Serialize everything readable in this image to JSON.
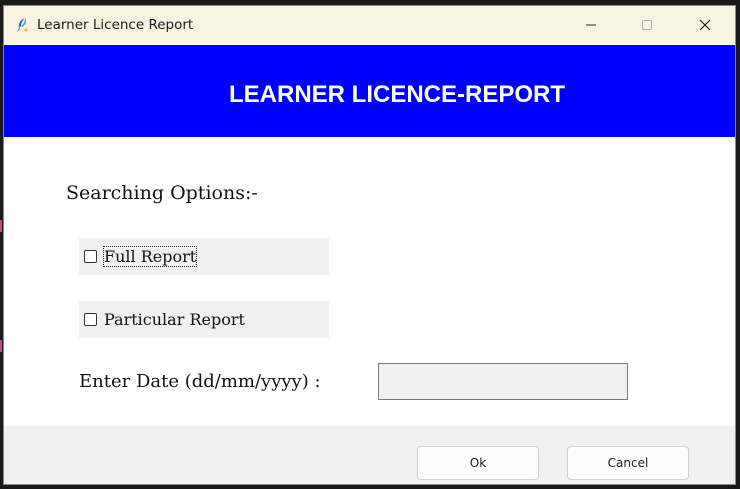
{
  "window": {
    "title": "Learner Licence Report",
    "icon": "python-feather-icon",
    "controls": [
      "minimize-icon",
      "maximize-icon",
      "close-icon"
    ]
  },
  "banner": {
    "title": "LEARNER LICENCE-REPORT",
    "color": "#0000fe"
  },
  "form": {
    "section_label": "Searching Options:-",
    "options": [
      {
        "label": "Full Report",
        "checked": false,
        "focused": true
      },
      {
        "label": "Particular Report",
        "checked": false,
        "focused": false
      }
    ],
    "date_label": "Enter Date (dd/mm/yyyy) :",
    "date_value": ""
  },
  "footer": {
    "ok_label": "Ok",
    "cancel_label": "Cancel"
  }
}
